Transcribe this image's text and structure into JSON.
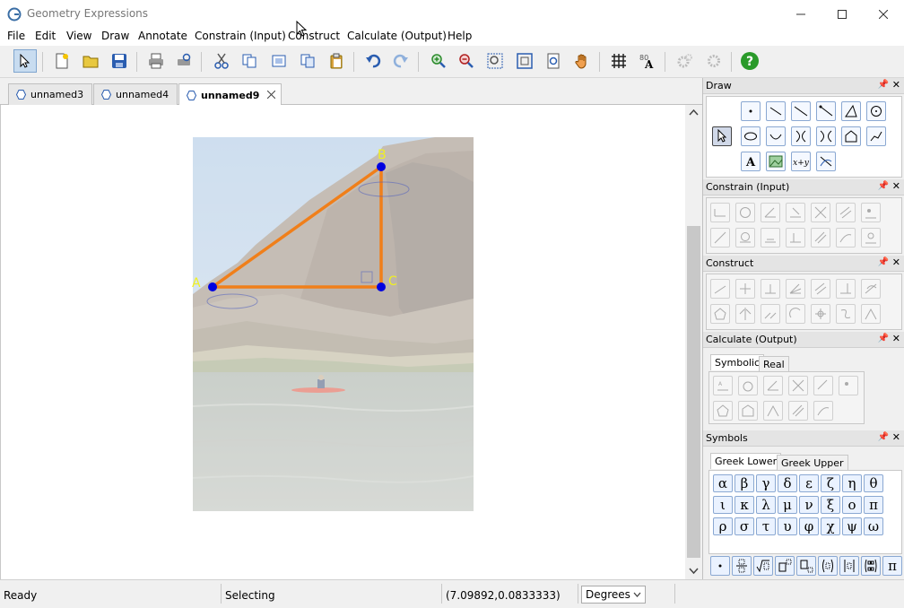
{
  "window": {
    "title": "Geometry Expressions"
  },
  "menu": [
    "File",
    "Edit",
    "View",
    "Draw",
    "Annotate",
    "Constrain (Input)",
    "Construct",
    "Calculate (Output)",
    "Help"
  ],
  "tabs": [
    {
      "label": "unnamed3"
    },
    {
      "label": "unnamed4"
    },
    {
      "label": "unnamed9",
      "active": true
    }
  ],
  "points": {
    "a": "A",
    "b": "B",
    "c": "C"
  },
  "panels": {
    "draw": "Draw",
    "constrain": "Constrain (Input)",
    "construct": "Construct",
    "calculate": "Calculate (Output)",
    "calc_tabs": [
      "Symbolic",
      "Real"
    ],
    "symbols": "Symbols",
    "symbol_tabs": [
      "Greek Lower",
      "Greek Upper"
    ]
  },
  "greek_lower": [
    "α",
    "β",
    "γ",
    "δ",
    "ε",
    "ζ",
    "η",
    "θ",
    "ι",
    "κ",
    "λ",
    "μ",
    "ν",
    "ξ",
    "ο",
    "π",
    "ρ",
    "σ",
    "τ",
    "υ",
    "φ",
    "χ",
    "ψ",
    "ω"
  ],
  "status": {
    "state": "Ready",
    "mode": "Selecting",
    "coords": "(7.09892,0.0833333)",
    "angle_unit": "Degrees"
  },
  "colors": {
    "triangle": "#f07f1a",
    "point": "#0000e0",
    "label": "#f0f020"
  }
}
